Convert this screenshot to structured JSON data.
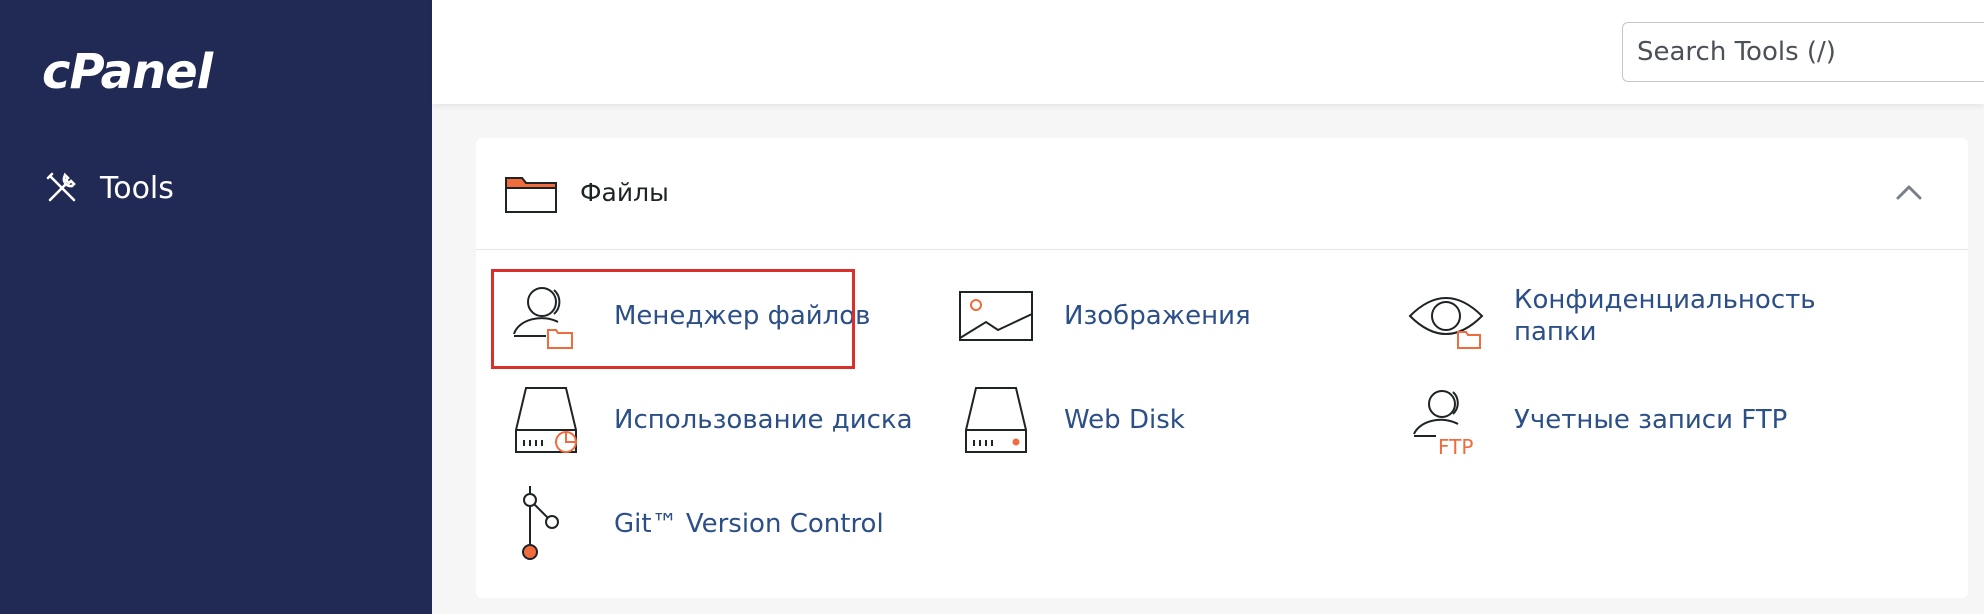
{
  "sidebar": {
    "logo": "cPanel",
    "items": [
      {
        "label": "Tools",
        "icon": "tools-icon"
      }
    ]
  },
  "search": {
    "placeholder": "Search Tools (/)"
  },
  "section": {
    "title": "Файлы",
    "icon": "folder-icon",
    "collapse_icon": "chevron-up-icon",
    "tools": [
      {
        "label": "Менеджер файлов",
        "icon": "file-manager-icon",
        "highlighted": true
      },
      {
        "label": "Изображения",
        "icon": "images-icon"
      },
      {
        "label": "Конфиденциальность папки",
        "icon": "directory-privacy-icon"
      },
      {
        "label": "Использование диска",
        "icon": "disk-usage-icon"
      },
      {
        "label": "Web Disk",
        "icon": "web-disk-icon"
      },
      {
        "label": "Учетные записи FTP",
        "icon": "ftp-accounts-icon"
      },
      {
        "label": "Git™ Version Control",
        "icon": "git-icon"
      }
    ]
  },
  "colors": {
    "sidebar_bg": "#212a54",
    "link": "#2b4f86",
    "accent_orange": "#f26b3d",
    "highlight_border": "#d9302b"
  }
}
